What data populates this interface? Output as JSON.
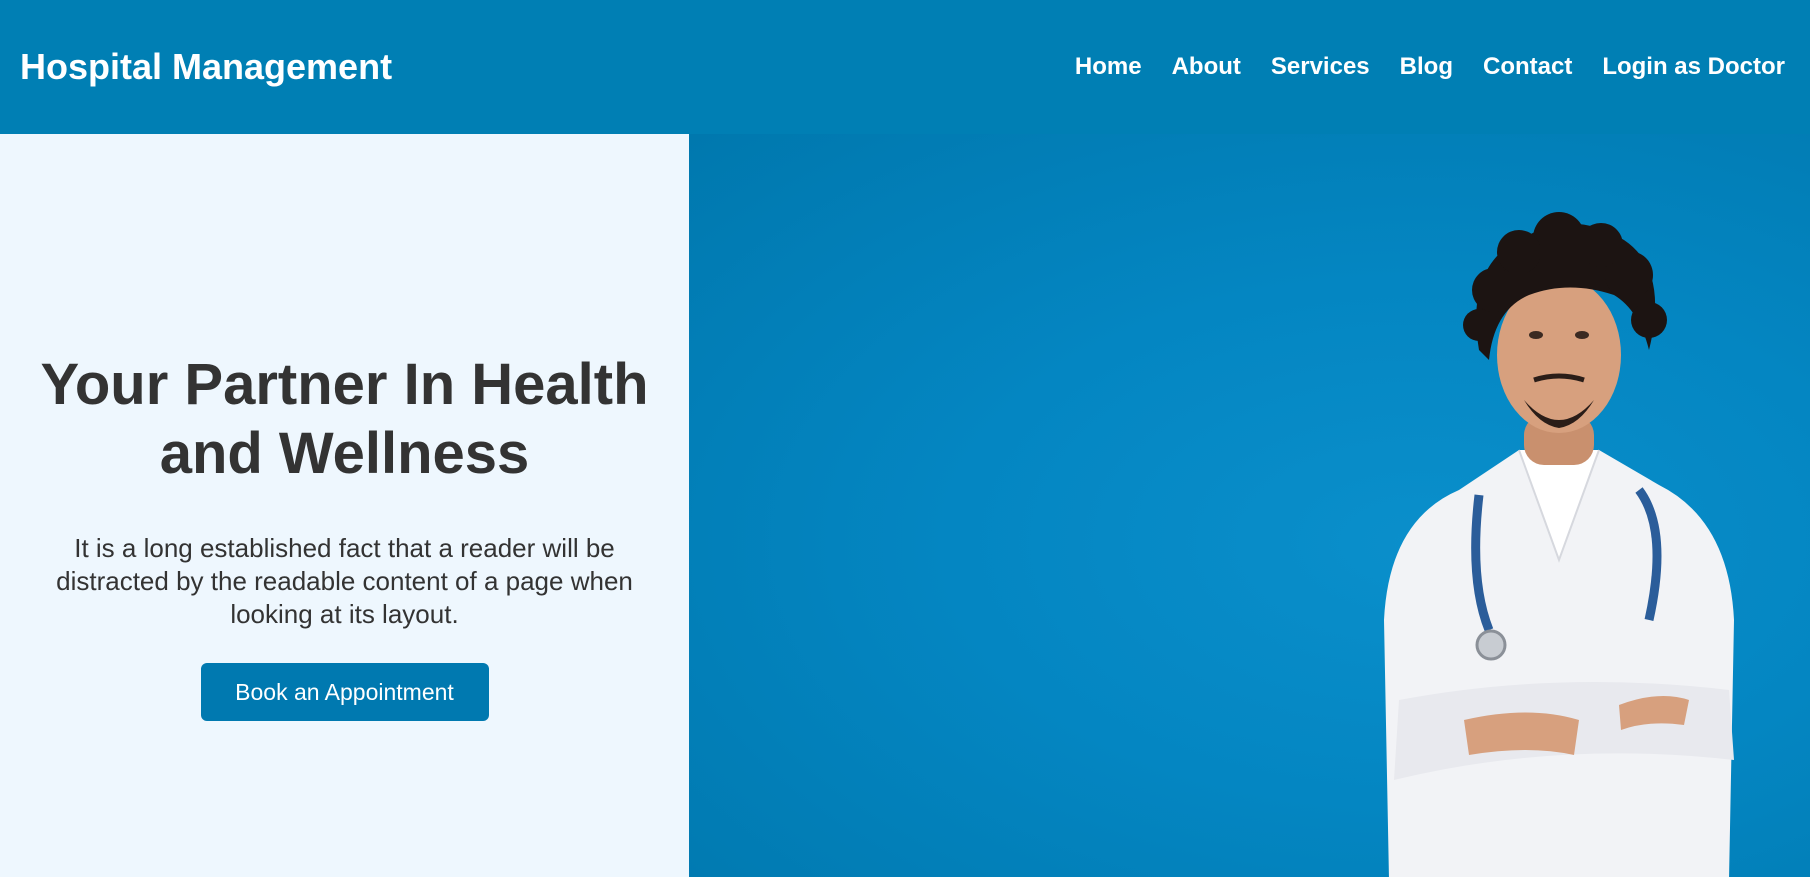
{
  "header": {
    "brand": "Hospital Management",
    "nav": [
      "Home",
      "About",
      "Services",
      "Blog",
      "Contact",
      "Login as Doctor"
    ]
  },
  "hero": {
    "title_line1": "Your Partner In Health",
    "title_line2": "and Wellness",
    "description": "It is a long established fact that a reader will be distracted by the readable content of a page when looking at its layout.",
    "cta_label": "Book an Appointment"
  },
  "colors": {
    "header_bg": "#007fb4",
    "hero_left_bg": "#eef7fe",
    "hero_right_bg": "#0486c2",
    "cta_bg": "#0079b0",
    "text_dark": "#333333"
  }
}
